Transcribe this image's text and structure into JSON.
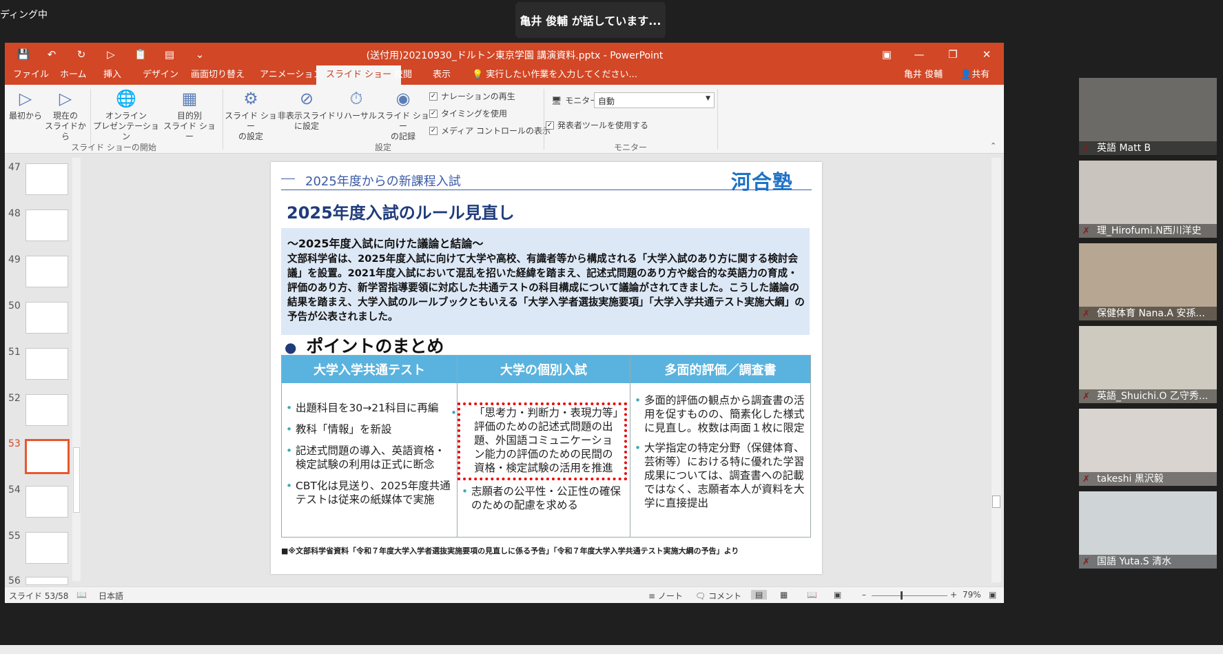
{
  "zoom": {
    "meeting_label": "ディング中",
    "speaker_text": "亀井 俊輔 が話しています..."
  },
  "ppt": {
    "window_title": "(送付用)20210930_ドルトン東京学園 講演資料.pptx - PowerPoint",
    "tabs": [
      "ファイル",
      "ホーム",
      "挿入",
      "デザイン",
      "画面切り替え",
      "アニメーション",
      "スライド ショー",
      "校閲",
      "表示"
    ],
    "tell_me": "実行したい作業を入力してください...",
    "user": "亀井 俊輔",
    "share": "共有",
    "ribbon": {
      "from_start": "最初から",
      "from_current": [
        "現在の",
        "スライドから"
      ],
      "online": [
        "オンライン",
        "プレゼンテーション"
      ],
      "custom": [
        "目的別",
        "スライド ショー"
      ],
      "setup": [
        "スライド ショー",
        "の設定"
      ],
      "hide": [
        "非表示スライド",
        "に設定"
      ],
      "rehearse": "リハーサル",
      "record": [
        "スライド ショー",
        "の記録"
      ],
      "chk_narration": "ナレーションの再生",
      "chk_timing": "タイミングを使用",
      "chk_media": "メディア コントロールの表示",
      "monitor_label": "モニター:",
      "monitor_value": "自動",
      "presenter": "発表者ツールを使用する",
      "group_start": "スライド ショーの開始",
      "group_setup": "設定",
      "group_monitor": "モニター"
    },
    "thumbs": [
      "47",
      "48",
      "49",
      "50",
      "51",
      "52",
      "53",
      "54",
      "55",
      "56"
    ],
    "status": {
      "slide": "スライド 53/58",
      "lang": "日本語",
      "notes": "ノート",
      "comments": "コメント",
      "zoom": "79%"
    }
  },
  "slide": {
    "header": "2025年度からの新課程入試",
    "logo": "河合塾",
    "title": "2025年度入試のルール見直し",
    "box_title": "～2025年度入試に向けた議論と結論～",
    "box_text": "文部科学省は、2025年度入試に向けて大学や高校、有識者等から構成される「大学入試のあり方に関する検討会議」を設置。2021年度入試において混乱を招いた経緯を踏まえ、記述式問題のあり方や総合的な英語力の育成・評価のあり方、新学習指導要領に対応した共通テストの科目構成について議論がされてきました。こうした議論の結果を踏まえ、大学入試のルールブックともいえる「大学入学者選抜実施要項」「大学入学共通テスト実施大綱」の予告が公表されました。",
    "points_title": "ポイントのまとめ",
    "columns": [
      {
        "head": "大学入学共通テスト",
        "items": [
          "出題科目を30→21科目に再編",
          "教科「情報」を新設",
          "記述式問題の導入、英語資格・検定試験の利用は正式に断念",
          "CBT化は見送り、2025年度共通テストは従来の紙媒体で実施"
        ]
      },
      {
        "head": "大学の個別入試",
        "items": [
          "「思考力・判断力・表現力等」評価のための記述式問題の出題、外国語コミュニケーション能力の評価のための民間の資格・検定試験の活用を推進",
          "志願者の公平性・公正性の確保のための配慮を求める"
        ]
      },
      {
        "head": "多面的評価／調査書",
        "items": [
          "多面的評価の観点から調査書の活用を促すものの、簡素化した様式に見直し。枚数は両面１枚に限定",
          "大学指定の特定分野（保健体育、芸術等）における特に優れた学習成果については、調査書への記載ではなく、志願者本人が資料を大学に直接提出"
        ]
      }
    ],
    "footnote": "■※文部科学省資料「令和７年度大学入学者選抜実施要項の見直しに係る予告」「令和７年度大学入学共通テスト実施大綱の予告」より"
  },
  "participants": [
    "英語 Matt B",
    "理_Hirofumi.N西川洋史",
    "保健体育 Nana.A 安孫...",
    "英語_Shuichi.O 乙守秀...",
    "takeshi 黒沢毅",
    "国語 Yuta.S 清水"
  ],
  "tile_colors": [
    "#6b6a66",
    "#c9c4bd",
    "#b7a792",
    "#cfcabf",
    "#d9d4cf",
    "#cfd4d6"
  ]
}
